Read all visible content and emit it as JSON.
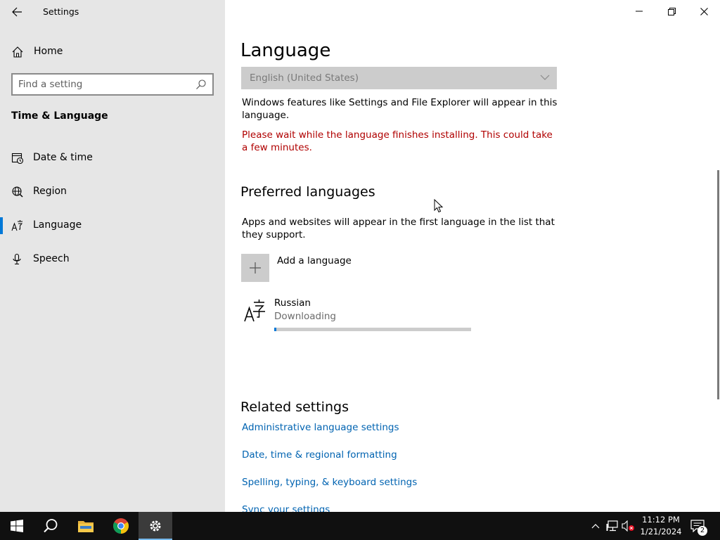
{
  "window": {
    "title": "Settings"
  },
  "sidebar": {
    "home_label": "Home",
    "search_placeholder": "Find a setting",
    "section_title": "Time & Language",
    "items": [
      {
        "label": "Date & time",
        "icon": "date-time-icon"
      },
      {
        "label": "Region",
        "icon": "region-globe-icon"
      },
      {
        "label": "Language",
        "icon": "language-icon",
        "active": true
      },
      {
        "label": "Speech",
        "icon": "microphone-icon"
      }
    ]
  },
  "main": {
    "title": "Language",
    "display_language": "English (United States)",
    "display_language_desc": "Windows features like Settings and File Explorer will appear in this language.",
    "install_warning": "Please wait while the language finishes installing. This could take a few minutes.",
    "preferred_title": "Preferred languages",
    "preferred_desc": "Apps and websites will appear in the first language in the list that they support.",
    "add_language_label": "Add a language",
    "languages": [
      {
        "name": "Russian",
        "status": "Downloading",
        "progress": 0.01
      }
    ],
    "related_title": "Related settings",
    "related_links": [
      "Administrative language settings",
      "Date, time & regional formatting",
      "Spelling, typing, & keyboard settings",
      "Sync your settings"
    ]
  },
  "taskbar": {
    "time": "11:12 PM",
    "date": "1/21/2024",
    "notification_count": "2",
    "apps": [
      "start-icon",
      "search-icon",
      "file-explorer-icon",
      "chrome-icon",
      "settings-icon"
    ]
  },
  "colors": {
    "accent": "#0078d7",
    "link": "#0063b1",
    "warning": "#b00000",
    "sidebar_bg": "#e6e6e6",
    "taskbar_bg": "#101010"
  }
}
